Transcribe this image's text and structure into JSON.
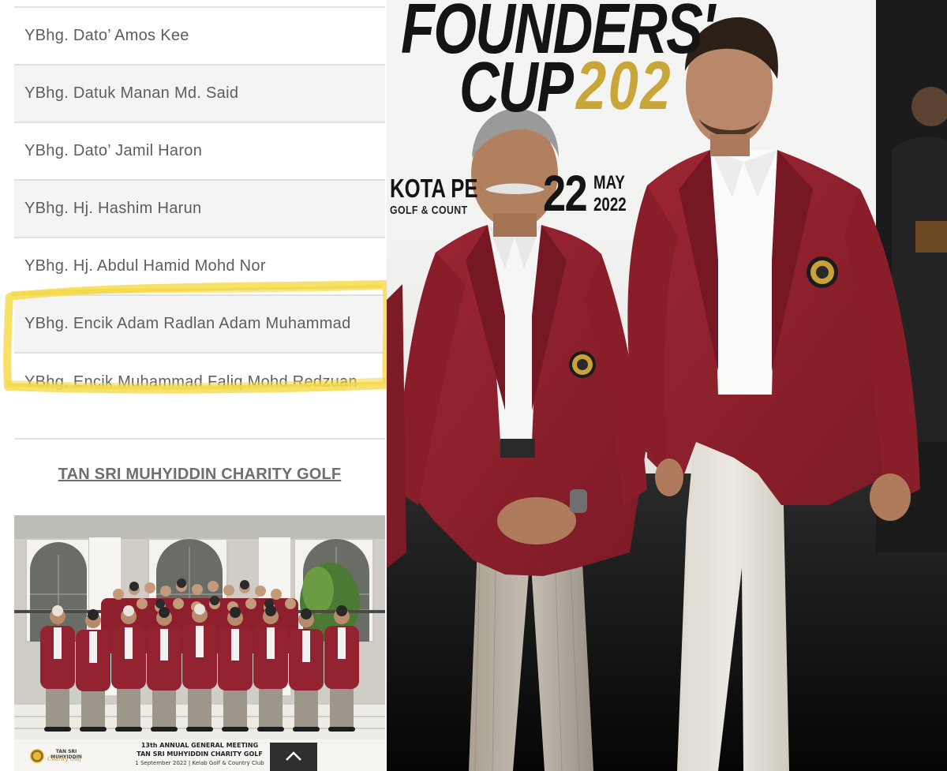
{
  "names_list": [
    {
      "label": "YBhg. Dato’ Amos Kee"
    },
    {
      "label": "YBhg. Datuk Manan Md. Said"
    },
    {
      "label": "YBhg. Dato’ Jamil Haron"
    },
    {
      "label": "YBhg. Hj. Hashim Harun"
    },
    {
      "label": "YBhg. Hj. Abdul Hamid Mohd Nor"
    },
    {
      "label": "YBhg. Encik Adam Radlan Adam Muhammad",
      "highlighted": true
    },
    {
      "label": "YBhg. Encik Muhammad Faliq Mohd Redzuan"
    }
  ],
  "section_link": "TAN SRI MUHYIDDIN CHARITY GOLF",
  "group_photo": {
    "caption_line1": "13th ANNUAL GENERAL MEETING",
    "caption_line2": "TAN SRI MUHYIDDIN CHARITY GOLF",
    "caption_line3": "1 September 2022 | Kelab Golf & Country Club",
    "logo_line1": "TAN SRI MUHYIDDIN",
    "logo_line2": "Charity Golf"
  },
  "scroll_top_icon": "chevron-up-icon",
  "event_banner": {
    "title_line1": "FOUNDERS' ",
    "title_line2": "CUP ",
    "title_year": "202",
    "venue_line1": "KOTA PE",
    "venue_line2": "GOLF & COUNT",
    "date_day": "22",
    "date_month": "MAY",
    "date_year": "2022"
  },
  "colors": {
    "highlight_yellow": "#f6dc4e",
    "blazer_maroon": "#8e1f2c",
    "banner_gold": "#c9a63a",
    "list_text": "#5e5e5e"
  }
}
